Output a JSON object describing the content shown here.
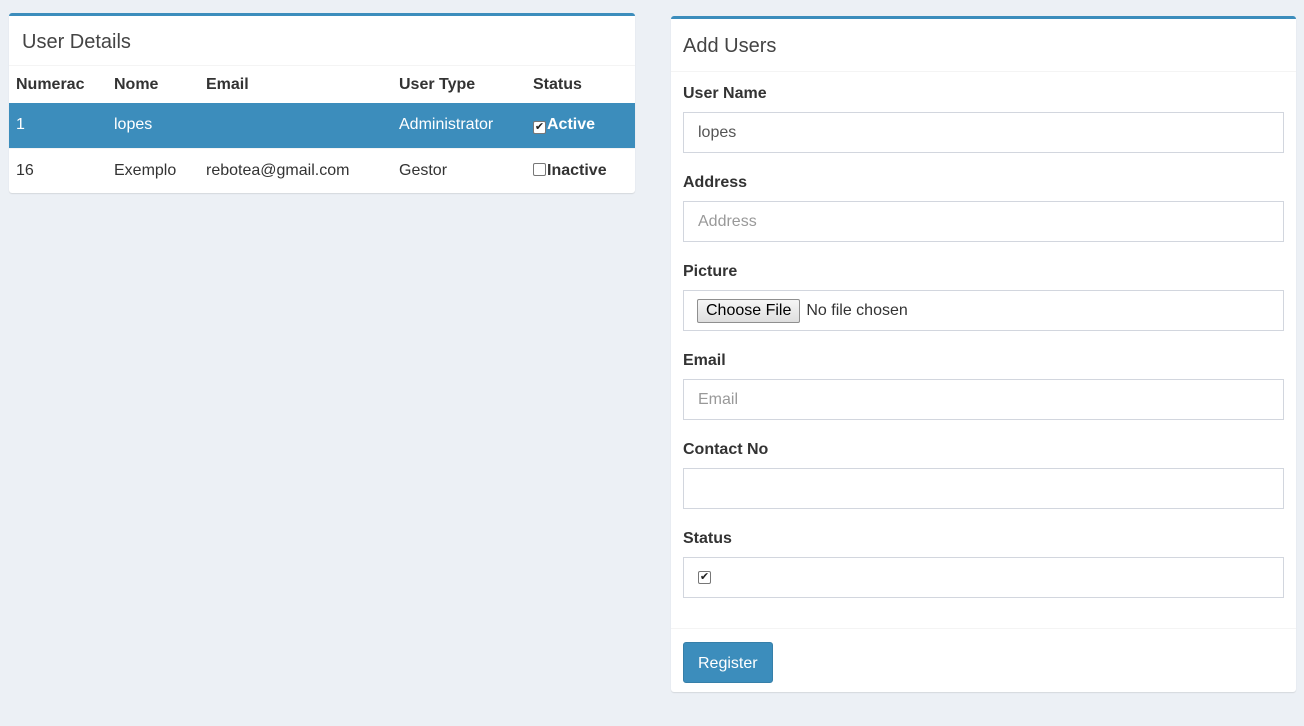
{
  "user_details": {
    "title": "User Details",
    "columns": [
      "Numerac",
      "Nome",
      "Email",
      "User Type",
      "Status"
    ],
    "rows": [
      {
        "num": "1",
        "name": "lopes",
        "email": "",
        "type": "Administrator",
        "status": "Active",
        "checked": true
      },
      {
        "num": "16",
        "name": "Exemplo",
        "email": "rebotea@gmail.com",
        "type": "Gestor",
        "status": "Inactive",
        "checked": false
      }
    ]
  },
  "add_users": {
    "title": "Add Users",
    "user_name": {
      "label": "User Name",
      "value": "lopes"
    },
    "address": {
      "label": "Address",
      "placeholder": "Address"
    },
    "picture": {
      "label": "Picture",
      "button": "Choose File",
      "status": "No file chosen"
    },
    "email": {
      "label": "Email",
      "placeholder": "Email"
    },
    "contact": {
      "label": "Contact No",
      "value": ""
    },
    "status": {
      "label": "Status",
      "checked": true
    },
    "register_label": "Register"
  },
  "colors": {
    "accent": "#3c8dbc",
    "background": "#ecf0f5"
  }
}
